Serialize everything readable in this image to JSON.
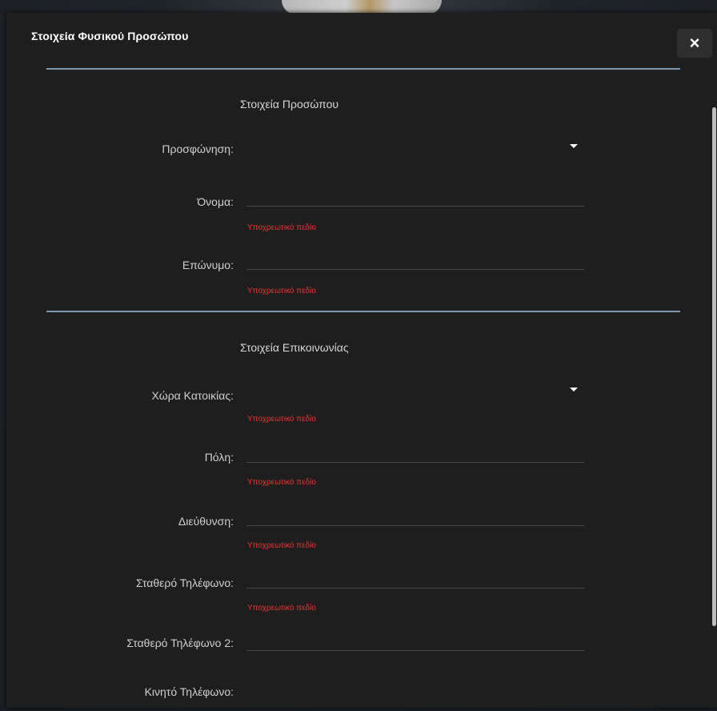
{
  "dialog": {
    "title": "Στοιχεία Φυσικού Προσώπου",
    "close_label": "×"
  },
  "sections": [
    {
      "title": "Στοιχεία Προσώπου"
    },
    {
      "title": "Στοιχεία Επικοινωνίας"
    }
  ],
  "fields": {
    "salutation": {
      "label": "Προσφώνηση:",
      "value": ""
    },
    "first_name": {
      "label": "Όνομα:",
      "value": "",
      "error": "Υποχρεωτικό πεδίο"
    },
    "last_name": {
      "label": "Επώνυμο:",
      "value": "",
      "error": "Υποχρεωτικό πεδίο"
    },
    "country": {
      "label": "Χώρα Κατοικίας:",
      "value": "",
      "error": "Υποχρεωτικό πεδίο"
    },
    "city": {
      "label": "Πόλη:",
      "value": "",
      "error": "Υποχρεωτικό πεδίο"
    },
    "address": {
      "label": "Διεύθυνση:",
      "value": "",
      "error": "Υποχρεωτικό πεδίο"
    },
    "landline": {
      "label": "Σταθερό Τηλέφωνο:",
      "value": "",
      "error": "Υποχρεωτικό πεδίο"
    },
    "landline2": {
      "label": "Σταθερό Τηλέφωνο 2:",
      "value": ""
    },
    "mobile": {
      "label": "Κινητό Τηλέφωνο:",
      "value": ""
    }
  },
  "colors": {
    "error": "#e53935",
    "divider": "#7c97b0",
    "dialog_bg": "#1e1e1e"
  }
}
